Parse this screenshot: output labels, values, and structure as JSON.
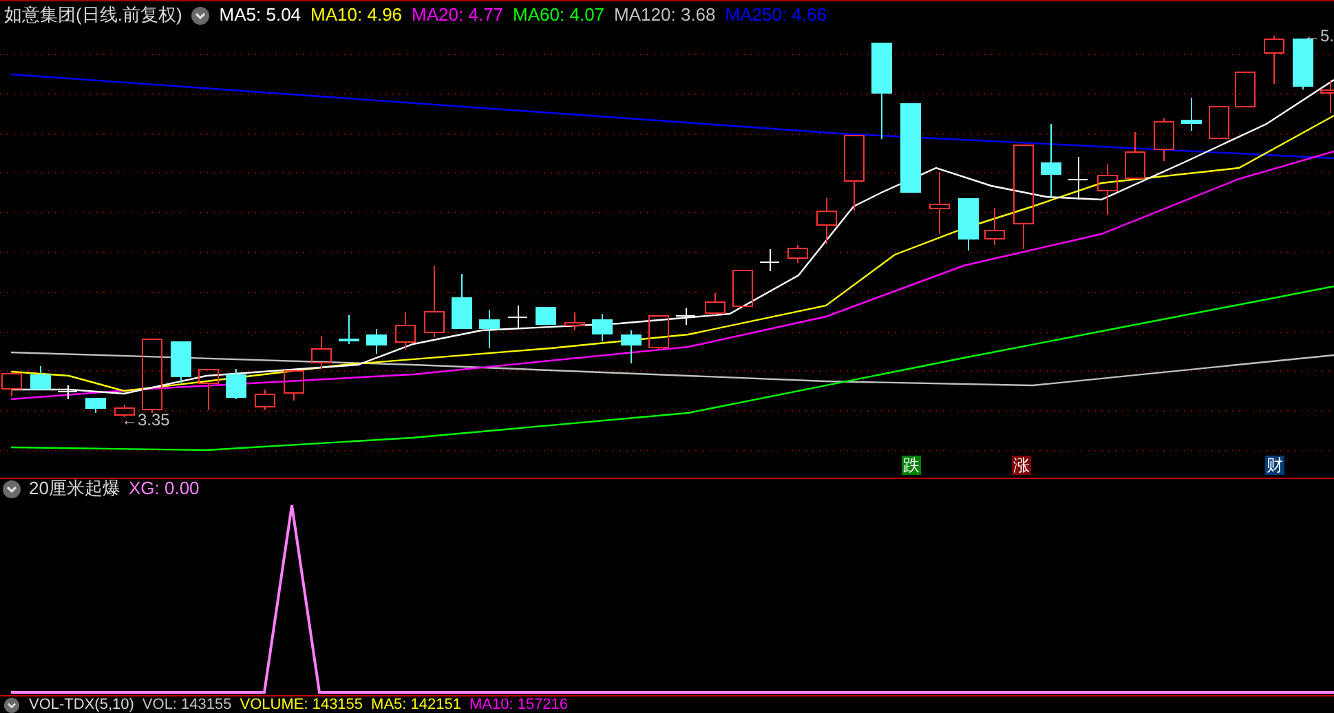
{
  "main_panel": {
    "title": "如意集团(日线.前复权)",
    "indicators": [
      {
        "label": "MA5: 5.04",
        "color": "#ffffff"
      },
      {
        "label": "MA10: 4.96",
        "color": "#ffff00"
      },
      {
        "label": "MA20: 4.77",
        "color": "#ff00ff"
      },
      {
        "label": "MA60: 4.07",
        "color": "#00ff00"
      },
      {
        "label": "MA120: 3.68",
        "color": "#c0c0c0"
      },
      {
        "label": "MA250: 4.66",
        "color": "#0000ff"
      }
    ],
    "low_label": "←3.35",
    "high_label": "←5.",
    "signals": [
      {
        "label": "跌",
        "color": "#008000"
      },
      {
        "label": "涨",
        "color": "#800000"
      },
      {
        "label": "财",
        "color": "#003c78"
      }
    ]
  },
  "indicator_panel": {
    "name": "20厘米起爆",
    "value": "XG: 0.00"
  },
  "volume_panel": {
    "name": "VOL-TDX(5,10)",
    "values": [
      {
        "label": "VOL: 143155",
        "color": "#c0c0c0"
      },
      {
        "label": "VOLUME: 143155",
        "color": "#ffff00"
      },
      {
        "label": "MA5: 142151",
        "color": "#ffff00"
      },
      {
        "label": "MA10: 157216",
        "color": "#ff00ff"
      }
    ]
  }
}
